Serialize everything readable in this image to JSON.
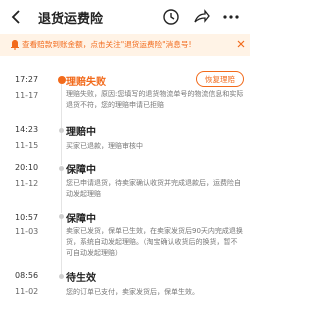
{
  "header": {
    "title": "退货运费险",
    "back_icon": "back-arrow-icon",
    "icons": [
      "clock-icon",
      "share-icon",
      "more-icon"
    ]
  },
  "banner": {
    "text": "查看赔款到账金额，点击关注\"退货运费险\"消息号!",
    "icon": "bell-icon"
  },
  "timeline": [
    {
      "time": "17:27",
      "date": "11-17",
      "title": "理赔失败",
      "active": true,
      "desc": "理赔失败，原因:您填写的退货物流单号的物流信息和实际退货不符，您的理赔申请已拒赔",
      "button": "恢复理赔"
    },
    {
      "time": "14:23",
      "date": "11-15",
      "title": "理赔中",
      "desc": "买家已退款，理赔审核中"
    },
    {
      "time": "20:10",
      "date": "11-12",
      "title": "保障中",
      "desc": "您已申请退货，待卖家确认收货并完成退款后，运费险自动发起理赔"
    },
    {
      "time": "10:57",
      "date": "11-03",
      "title": "保障中",
      "desc": "卖家已发货，保单已生效，在卖家发货后90天内完成退换货，系统自动发起理赔。（淘宝确认收货后的换货，暂不可自动发起理赔）"
    },
    {
      "time": "08:56",
      "date": "11-02",
      "title": "待生效",
      "desc": "您的订单已支付，卖家发货后，保单生效。"
    }
  ],
  "colors": {
    "accent": "#f26a1b",
    "banner_bg": "#fff3e6"
  }
}
